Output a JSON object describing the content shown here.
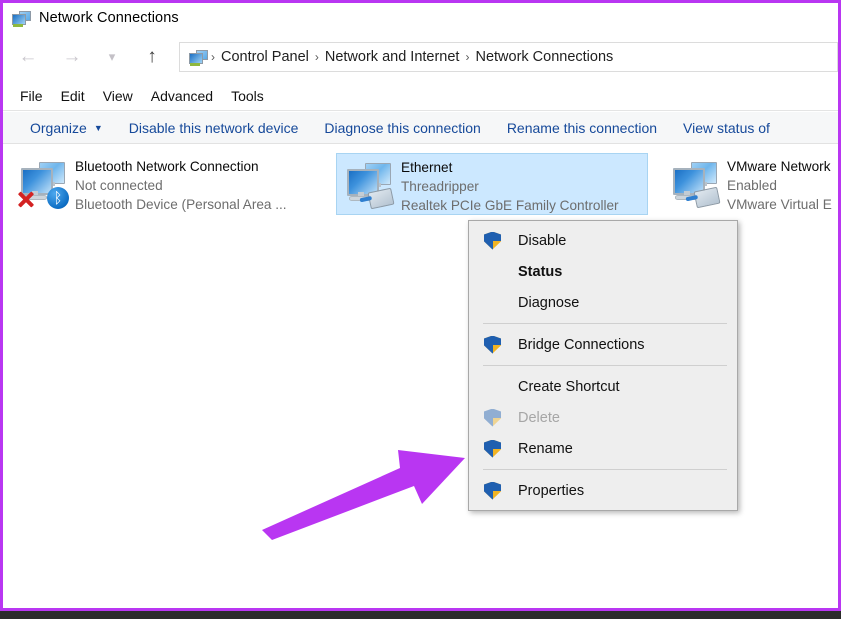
{
  "window": {
    "title": "Network Connections",
    "title_icon": "network-connections-icon"
  },
  "navigation": {
    "back_icon": "back-arrow-icon",
    "forward_icon": "forward-arrow-icon",
    "recent_icon": "chevron-down-icon",
    "up_icon": "up-arrow-icon",
    "breadcrumb": [
      "Control Panel",
      "Network and Internet",
      "Network Connections"
    ],
    "separator": "›"
  },
  "menubar": {
    "items": [
      "File",
      "Edit",
      "View",
      "Advanced",
      "Tools"
    ]
  },
  "toolbar": {
    "items": [
      {
        "label": "Organize",
        "caret": "▼",
        "has_caret": true
      },
      {
        "label": "Disable this network device",
        "has_caret": false
      },
      {
        "label": "Diagnose this connection",
        "has_caret": false
      },
      {
        "label": "Rename this connection",
        "has_caret": false
      },
      {
        "label": "View status of",
        "has_caret": false
      }
    ]
  },
  "connections": [
    {
      "name": "Bluetooth Network Connection",
      "status": "Not connected",
      "device": "Bluetooth Device (Personal Area ...",
      "icon": "network-adapter-bluetooth-icon",
      "selected": false,
      "badge": "ᛒ"
    },
    {
      "name": "Ethernet",
      "status": "Threadripper",
      "device": "Realtek PCIe GbE Family Controller",
      "icon": "network-adapter-ethernet-icon",
      "selected": true
    },
    {
      "name": "VMware Network",
      "status": "Enabled",
      "device": "VMware Virtual E",
      "icon": "network-adapter-ethernet-icon",
      "selected": false
    }
  ],
  "context_menu": {
    "items": [
      {
        "label": "Disable",
        "shield": true,
        "bold": false,
        "disabled": false,
        "separator_after": false
      },
      {
        "label": "Status",
        "shield": false,
        "bold": true,
        "disabled": false,
        "separator_after": false
      },
      {
        "label": "Diagnose",
        "shield": false,
        "bold": false,
        "disabled": false,
        "separator_after": true
      },
      {
        "label": "Bridge Connections",
        "shield": true,
        "bold": false,
        "disabled": false,
        "separator_after": true
      },
      {
        "label": "Create Shortcut",
        "shield": false,
        "bold": false,
        "disabled": false,
        "separator_after": false
      },
      {
        "label": "Delete",
        "shield": true,
        "bold": false,
        "disabled": true,
        "separator_after": false
      },
      {
        "label": "Rename",
        "shield": true,
        "bold": false,
        "disabled": false,
        "separator_after": true
      },
      {
        "label": "Properties",
        "shield": true,
        "bold": false,
        "disabled": false,
        "separator_after": false
      }
    ]
  },
  "annotation": {
    "arrow_color": "#b936f2",
    "points_to": "Properties",
    "border_color": "#b936f2"
  },
  "colors": {
    "selection": "#cce8ff",
    "toolbar_link": "#16499a",
    "menu_bg": "#eeeeee",
    "shield_blue": "#1f5fb0",
    "shield_gold": "#f0b323"
  }
}
